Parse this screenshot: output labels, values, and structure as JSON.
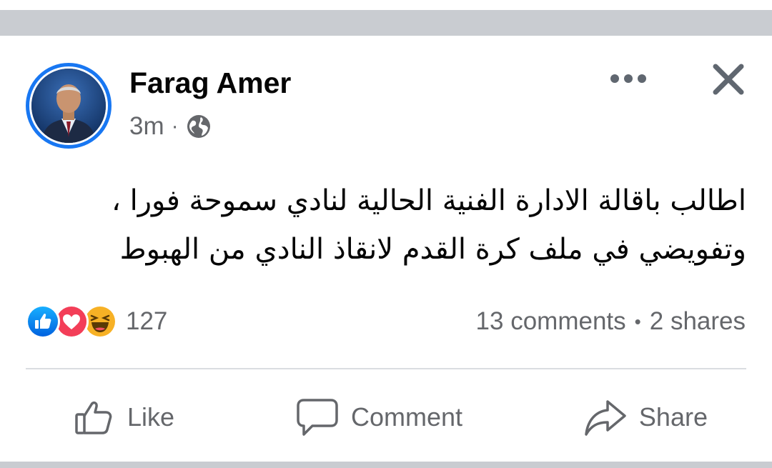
{
  "post": {
    "author": "Farag Amer",
    "time": "3m",
    "separator": "·",
    "privacy_icon": "globe-icon",
    "text_lines": [
      "اطالب باقالة الادارة الفنية الحالية لنادي سموحة فورا ،",
      "وتفويضي في ملف كرة القدم لانقاذ النادي من الهبوط"
    ],
    "reactions": {
      "icons": [
        "like-reaction-icon",
        "love-reaction-icon",
        "haha-reaction-icon"
      ],
      "count": "127"
    },
    "comments": "13 comments",
    "stats_separator": "•",
    "shares": "2 shares"
  },
  "actions": {
    "like_label": "Like",
    "comment_label": "Comment",
    "share_label": "Share"
  },
  "colors": {
    "accent": "#1877f2",
    "text_primary": "#050505",
    "text_secondary": "#65676b",
    "love_red": "#f33e58",
    "haha_yellow": "#f7b125",
    "band_gray": "#c9ccd1"
  }
}
